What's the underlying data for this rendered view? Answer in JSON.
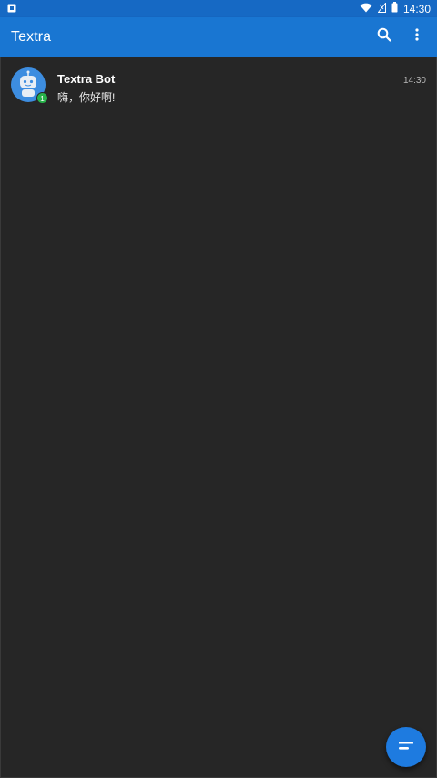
{
  "status_bar": {
    "time": "14:30",
    "icons": [
      "app-notification-icon",
      "wifi-icon",
      "no-signal-icon",
      "battery-icon"
    ],
    "color": "#1669c4"
  },
  "app_bar": {
    "title": "Textra",
    "color": "#1976d2",
    "actions": [
      "search-icon",
      "more-vert-icon"
    ]
  },
  "conversations": [
    {
      "name": "Textra Bot",
      "snippet": "嗨，你好啊!",
      "time": "14:30",
      "unread": "1",
      "avatar_icon": "robot-icon"
    }
  ],
  "fab": {
    "icon": "compose-icon",
    "color": "#1e7be0"
  }
}
